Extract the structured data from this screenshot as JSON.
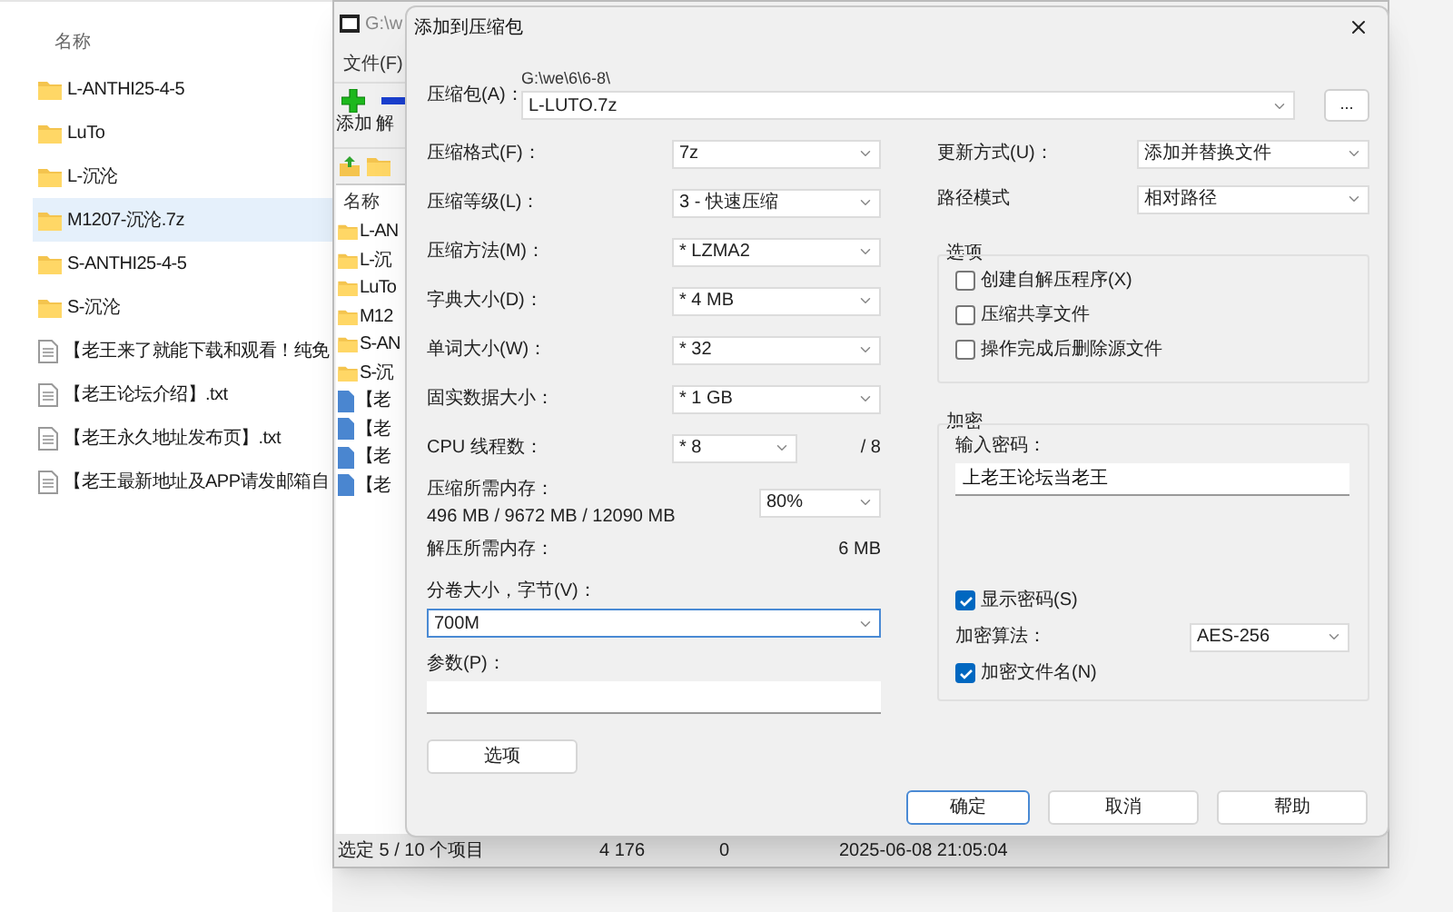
{
  "explorer": {
    "column_header": "名称",
    "items": [
      {
        "name": "L-ANTHI25-4-5",
        "kind": "folder",
        "selected": false
      },
      {
        "name": "LuTo",
        "kind": "folder",
        "selected": false
      },
      {
        "name": "L-沉沦",
        "kind": "folder",
        "selected": false
      },
      {
        "name": "M1207-沉沦.7z",
        "kind": "folder",
        "selected": true
      },
      {
        "name": "S-ANTHI25-4-5",
        "kind": "folder",
        "selected": false
      },
      {
        "name": "S-沉沦",
        "kind": "folder",
        "selected": false
      },
      {
        "name": "【老王来了就能下载和观看！纯免",
        "kind": "text",
        "selected": false
      },
      {
        "name": "【老王论坛介绍】.txt",
        "kind": "text",
        "selected": false
      },
      {
        "name": "【老王永久地址发布页】.txt",
        "kind": "text",
        "selected": false
      },
      {
        "name": "【老王最新地址及APP请发邮箱自",
        "kind": "text",
        "selected": false
      }
    ]
  },
  "archiver": {
    "title": "G:\\w",
    "menu": [
      "文件(F)"
    ],
    "toolbar": [
      {
        "label": "添加",
        "kind": "add"
      },
      {
        "label": "解",
        "kind": "extract"
      }
    ],
    "column_header": "名称",
    "items": [
      {
        "name": "L-AN",
        "kind": "folder"
      },
      {
        "name": "L-沉",
        "kind": "folder"
      },
      {
        "name": "LuTo",
        "kind": "folder"
      },
      {
        "name": "M12",
        "kind": "folder"
      },
      {
        "name": "S-AN",
        "kind": "folder"
      },
      {
        "name": "S-沉",
        "kind": "folder"
      },
      {
        "name": "【老",
        "kind": "file"
      },
      {
        "name": "【老",
        "kind": "file"
      },
      {
        "name": "【老",
        "kind": "file"
      },
      {
        "name": "【老",
        "kind": "file"
      }
    ],
    "status_bar": [
      "选定 5 / 10 个项目",
      "4 176",
      "0",
      "2025-06-08 21:05:04"
    ]
  },
  "dialog": {
    "title": "添加到压缩包",
    "archive": {
      "label": "压缩包(A)：",
      "path": "G:\\we\\6\\6-8\\",
      "value": "L-LUTO.7z",
      "browse": "..."
    },
    "settings": [
      {
        "label": "压缩格式(F)：",
        "value": "7z"
      },
      {
        "label": "压缩等级(L)：",
        "value": "3 - 快速压缩"
      },
      {
        "label": "压缩方法(M)：",
        "value": "* LZMA2"
      },
      {
        "label": "字典大小(D)：",
        "value": "* 4 MB"
      },
      {
        "label": "单词大小(W)：",
        "value": "* 32"
      },
      {
        "label": "固实数据大小：",
        "value": "* 1 GB"
      }
    ],
    "threads": {
      "label": "CPU 线程数：",
      "value": "* 8",
      "max": "/ 8"
    },
    "memory": {
      "label": "压缩所需内存：",
      "usage": "496 MB / 9672 MB / 12090 MB",
      "value": "80%"
    },
    "decompress_memory": {
      "label": "解压所需内存：",
      "value": "6 MB"
    },
    "volume": {
      "label": "分卷大小，字节(V)：",
      "value": "700M"
    },
    "parameters": {
      "label": "参数(P)："
    },
    "options_button": "选项",
    "update": {
      "label": "更新方式(U)：",
      "value": "添加并替换文件"
    },
    "path_mode": {
      "label": "路径模式",
      "value": "相对路径"
    },
    "options_group": {
      "title": "选项",
      "items": [
        {
          "label": "创建自解压程序(X)",
          "checked": false
        },
        {
          "label": "压缩共享文件",
          "checked": false
        },
        {
          "label": "操作完成后删除源文件",
          "checked": false
        }
      ]
    },
    "encryption": {
      "title": "加密",
      "password_label": "输入密码：",
      "password": "上老王论坛当老王",
      "show_password": {
        "label": "显示密码(S)",
        "checked": true
      },
      "method_label": "加密算法：",
      "method": "AES-256",
      "encrypt_names": {
        "label": "加密文件名(N)",
        "checked": true
      }
    },
    "buttons": [
      {
        "label": "确定",
        "default": true
      },
      {
        "label": "取消",
        "default": false
      },
      {
        "label": "帮助",
        "default": false
      }
    ]
  }
}
